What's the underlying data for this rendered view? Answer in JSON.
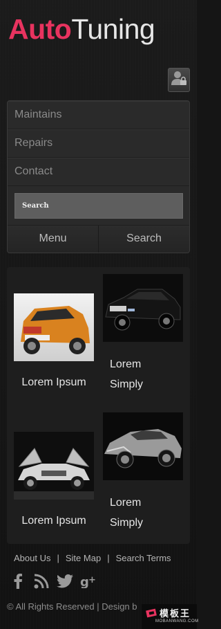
{
  "header": {
    "logo_part1": "Auto",
    "logo_part2": "Tuning"
  },
  "nav": {
    "items": [
      {
        "label": "Maintains"
      },
      {
        "label": "Repairs"
      },
      {
        "label": "Contact"
      }
    ]
  },
  "search": {
    "placeholder": "Search"
  },
  "tabs": [
    {
      "label": "Menu"
    },
    {
      "label": "Search"
    }
  ],
  "gallery": [
    {
      "caption": "Lorem Ipsum",
      "image": "orange-suv"
    },
    {
      "caption": "Lorem Simply",
      "image": "black-sedan"
    },
    {
      "caption": "Lorem Ipsum",
      "image": "silver-gullwing-coupe"
    },
    {
      "caption": "Lorem Simply",
      "image": "silver-concept-car"
    }
  ],
  "footer": {
    "links": [
      "About Us",
      "Site Map",
      "Search Terms"
    ],
    "social_icons": [
      "facebook-icon",
      "rss-icon",
      "twitter-icon",
      "google-plus-icon"
    ],
    "copyright": "© All Rights Reserved | Design b"
  },
  "watermark": {
    "title": "模板王",
    "subtitle": "MOBANWANG.COM"
  },
  "colors": {
    "accent": "#e8335f",
    "background": "#151515",
    "panel": "#2a2a2a"
  }
}
